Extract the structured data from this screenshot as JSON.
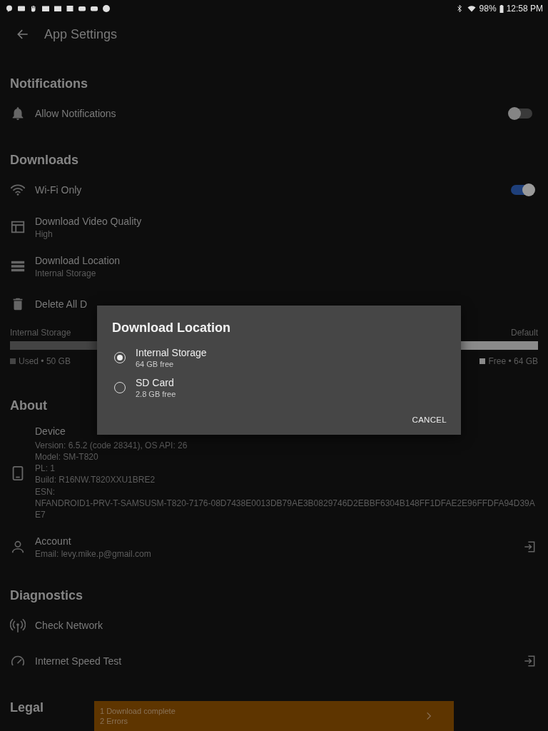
{
  "status_bar": {
    "battery": "98%",
    "time": "12:58 PM"
  },
  "toolbar": {
    "title": "App Settings"
  },
  "sections": [
    {
      "title": "Notifications",
      "items": [
        {
          "kind": "toggle",
          "label": "Allow Notifications",
          "on": false
        }
      ]
    },
    {
      "title": "Downloads",
      "items": [
        {
          "kind": "toggle",
          "label": "Wi-Fi Only",
          "on": true
        },
        {
          "kind": "detail",
          "label": "Download Video Quality",
          "value": "High"
        },
        {
          "kind": "detail",
          "label": "Download Location",
          "value": "Internal Storage"
        },
        {
          "kind": "action",
          "label": "Delete All D"
        },
        {
          "kind": "storage",
          "label": "Internal Storage",
          "note": "Default",
          "level": 0.44,
          "used": "Used • 50 GB",
          "free": "Free • 64 GB"
        }
      ]
    },
    {
      "title": "About",
      "items": [
        {
          "kind": "info",
          "label": "Device",
          "lines": [
            "Version: 6.5.2 (code 28341), OS API: 26",
            "Model: SM-T820",
            "PL: 1",
            "Build: R16NW.T820XXU1BRE2",
            "ESN:",
            "NFANDROID1-PRV-T-SAMSUSM-T820-7176-08D7438E0013DB79AE3B0829746D2EBBF6304B148FF1DFAE2E96FFDFA94D39AE7"
          ]
        },
        {
          "kind": "link",
          "label": "Account",
          "value": "Email: levy.mike.p@gmail.com"
        }
      ]
    },
    {
      "title": "Diagnostics",
      "items": [
        {
          "kind": "action",
          "label": "Check Network"
        },
        {
          "kind": "link",
          "label": "Internet Speed Test"
        }
      ]
    },
    {
      "title": "Legal"
    }
  ],
  "dialog": {
    "title": "Download Location",
    "options": [
      {
        "label": "Internal Storage",
        "detail": "64 GB free",
        "selected": true
      },
      {
        "label": "SD Card",
        "detail": "2.8 GB free",
        "selected": false
      }
    ],
    "button": "CANCEL"
  },
  "snackbar": {
    "lines": [
      "1 Download complete",
      "2 Errors"
    ]
  }
}
